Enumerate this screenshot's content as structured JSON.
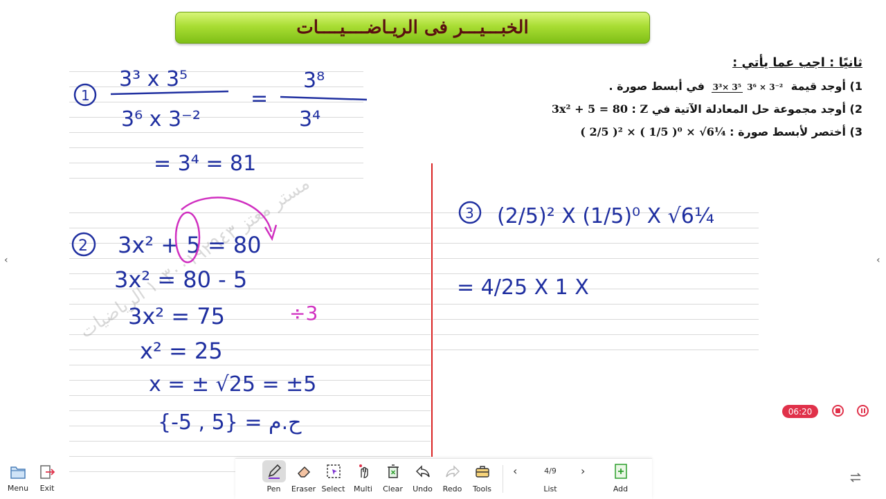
{
  "banner": {
    "title": "الخبـــيـــر فى الريـاضــــيــــات"
  },
  "questions": {
    "title": "ثانيًا : اجب عما يأتي :",
    "q1_prefix": "1) أوجد قيمة",
    "q1_num": "3³× 3⁵",
    "q1_den": "3⁶ × 3⁻²",
    "q1_suffix": "في أبسط صورة .",
    "q2_text": "2) أوجد مجموعة حل المعادلة الآتية في",
    "q2_set": "Z",
    "q2_eq": "3x² + 5 = 80",
    "q3_text": "3) أختصر لأبسط صورة :",
    "q3_expr": "( 2/5 )² × ( 1/5 )⁰ × √6¼"
  },
  "handwriting": {
    "sol1_circle": "1",
    "sol1_num": "3³ x 3⁵",
    "sol1_den": "3⁶ x 3⁻²",
    "sol1_eq": "=",
    "sol1_rhs_num": "3⁸",
    "sol1_rhs_den": "3⁴",
    "sol1_result": "= 3⁴ = 81",
    "sol2_circle": "2",
    "sol2_l1": "3x² + 5 = 80",
    "sol2_l2": "3x² = 80 - 5",
    "sol2_l3": "3x² = 75",
    "sol2_l4": "x² = 25",
    "sol2_l5": "x = ± √25 = ±5",
    "sol2_l6": "{-5 , 5} = ح.م",
    "sol2_note": "÷3",
    "sol3_circle": "3",
    "sol3_l1": "(2/5)² X (1/5)⁰ X √6¼",
    "sol3_l2": "= 4/25 X 1 X"
  },
  "watermark": {
    "text": "مستر معتز ١٠٣٠٠١٩٢٩٤٣ الرياضيات"
  },
  "recorder": {
    "time": "06:20"
  },
  "left_buttons": [
    {
      "label": "Menu",
      "icon": "folder-icon"
    },
    {
      "label": "Exit",
      "icon": "exit-icon"
    }
  ],
  "toolbar": {
    "tools": [
      {
        "label": "Pen",
        "icon": "pen-icon"
      },
      {
        "label": "Eraser",
        "icon": "eraser-icon"
      },
      {
        "label": "Select",
        "icon": "select-icon"
      },
      {
        "label": "Multi",
        "icon": "multi-touch-icon"
      },
      {
        "label": "Clear",
        "icon": "trash-icon"
      },
      {
        "label": "Undo",
        "icon": "undo-icon"
      },
      {
        "label": "Redo",
        "icon": "redo-icon"
      },
      {
        "label": "Tools",
        "icon": "toolbox-icon"
      }
    ],
    "page_count": "4/9",
    "list_label": "List",
    "add_label": "Add"
  },
  "colors": {
    "ink_blue": "#1f2fa0",
    "ink_magenta": "#d02fc0",
    "red_margin": "#d92323",
    "timer_red": "#e0314a"
  }
}
